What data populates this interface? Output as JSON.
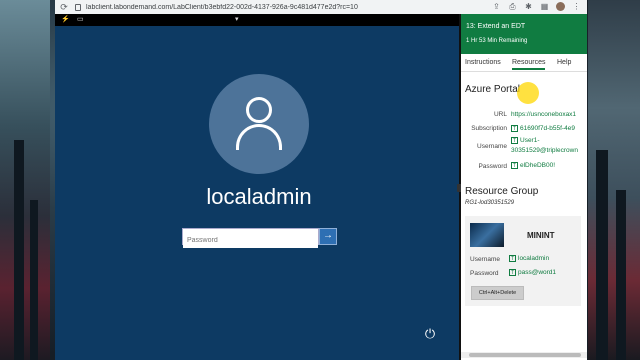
{
  "browser": {
    "url": "labclient.labondemand.com/LabClient/b3ebfd22-002d-4137-926a-9c481d477e2d?rc=10",
    "toolbar_icons": [
      "share-icon",
      "print-icon",
      "extensions-icon",
      "grid-icon",
      "avatar",
      "menu-icon"
    ]
  },
  "vm": {
    "toolbar_icons": [
      "lightning-icon",
      "monitor-icon",
      "chevron-down-icon"
    ],
    "login": {
      "username": "localadmin",
      "password_placeholder": "Password",
      "submit_glyph": "→",
      "power_glyph": "⏻"
    }
  },
  "panel": {
    "title": "13: Extend an EDT",
    "time_remaining": "1 Hr 53 Min Remaining",
    "tabs": [
      {
        "label": "Instructions",
        "active": false
      },
      {
        "label": "Resources",
        "active": true
      },
      {
        "label": "Help",
        "active": false
      }
    ],
    "azure_portal": {
      "heading": "Azure Portal",
      "url_label": "URL",
      "url_value": "https://usnconeboxax1",
      "subscription_label": "Subscription",
      "subscription_value": "61690f7d-b55f-4e9",
      "username_label": "Username",
      "username_value_1": "User1-",
      "username_value_2": "30351529@triplecrown",
      "password_label": "Password",
      "password_value": "elDheDB00!"
    },
    "resource_group": {
      "heading": "Resource Group",
      "id": "RG1-lod30351529"
    },
    "vm_card": {
      "name": "MININT",
      "username_label": "Username",
      "username_value": "localadmin",
      "password_label": "Password",
      "password_value": "pass@word1",
      "cad_button": "Ctrl+Alt+Delete"
    },
    "accent_color": "#107c41"
  }
}
